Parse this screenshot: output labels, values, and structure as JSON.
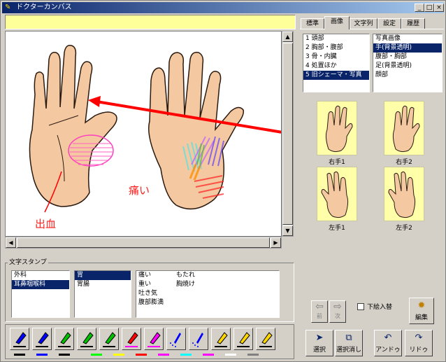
{
  "window": {
    "title": "ドクターカンバス",
    "controls": [
      "_",
      "□",
      "×"
    ]
  },
  "canvas": {
    "label_pain": "痛い",
    "label_bleed": "出血"
  },
  "tabs": [
    "標準",
    "画像",
    "文字列",
    "設定",
    "履歴"
  ],
  "active_tab": 1,
  "categories": [
    "1 頭部",
    "2 胸部・腹部",
    "3 骨・内臓",
    "4 処置ほか",
    "5 旧シェーマ・写真"
  ],
  "selected_category": 4,
  "images": [
    "写真画像",
    "手(背景透明)",
    "腹部・胸部",
    "足(背景透明)",
    "顔部"
  ],
  "selected_image": 1,
  "thumbnails": [
    "右手1",
    "右手2",
    "左手1",
    "左手2"
  ],
  "nav": {
    "prev": "前",
    "next": "次"
  },
  "checkbox_label": "下絵入替",
  "buttons": {
    "edit": "編集",
    "select": "選択",
    "deselect": "選択消し",
    "undo": "アンドゥ",
    "redo": "リドゥ"
  },
  "stamp": {
    "title": "文字スタンプ",
    "departments": [
      "外科",
      "耳鼻咽喉科"
    ],
    "selected_department": 1,
    "organs": [
      "胃",
      "胃腸"
    ],
    "selected_organ": 0,
    "symptoms_col1": [
      "痛い",
      "重い",
      "吐き気",
      "腹部膨満"
    ],
    "symptoms_col2": [
      "もたれ",
      "胸焼け"
    ]
  },
  "pen_colors": [
    "#0000ff",
    "#0000ff",
    "#00c000",
    "#00c000",
    "#00c000",
    "#ff0000",
    "#ff00ff",
    "#0000ff",
    "#0000ff",
    "#ffd700",
    "#ffd700",
    "#ffd700"
  ],
  "palette_colors": [
    "#000000",
    "#0000ff",
    "#00ff00",
    "#ffff00",
    "#ff0000",
    "#ff00ff",
    "#00ffff",
    "#ffffff",
    "#808080"
  ],
  "colors": {
    "title_bar": "#0a246a",
    "selection": "#0a246a",
    "input_bg": "#ffff99",
    "thumb_bg": "#ffffaa",
    "arrow": "#ff0000"
  }
}
